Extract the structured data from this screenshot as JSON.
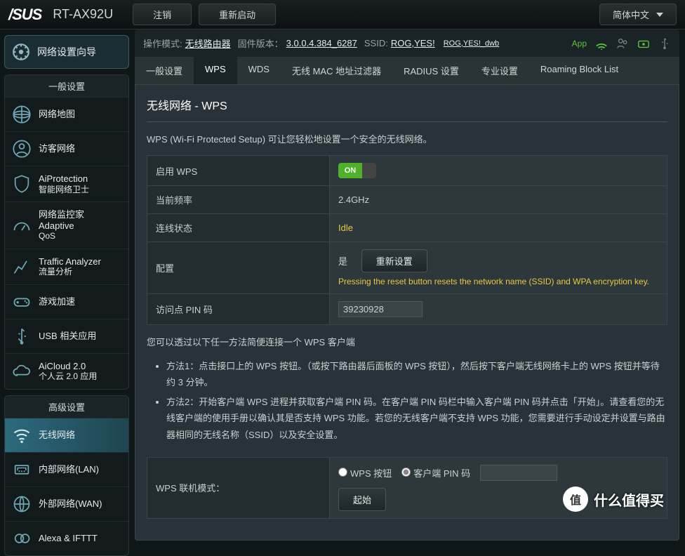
{
  "topbar": {
    "logo": "/SUS",
    "model": "RT-AX92U",
    "logout": "注销",
    "reboot": "重新启动",
    "lang": "简体中文"
  },
  "status": {
    "mode_label": "操作模式:",
    "mode": "无线路由器",
    "fw_label": "固件版本：",
    "fw": "3.0.0.4.384_6287",
    "ssid_label": "SSID:",
    "ssid1": "ROG,YES!",
    "ssid2": "ROG,YES!_dwb",
    "app": "App"
  },
  "wizard": "网络设置向导",
  "panel1_title": "一般设置",
  "panel2_title": "高级设置",
  "nav1": [
    {
      "l1": "网络地图"
    },
    {
      "l1": "访客网络"
    },
    {
      "l1": "AiProtection",
      "l2": "智能网络卫士"
    },
    {
      "l1": "网络监控家 Adaptive",
      "l2": "QoS"
    },
    {
      "l1": "Traffic Analyzer",
      "l2": "流量分析"
    },
    {
      "l1": "游戏加速"
    },
    {
      "l1": "USB 相关应用"
    },
    {
      "l1": "AiCloud 2.0",
      "l2": "个人云 2.0 应用"
    }
  ],
  "nav2": [
    {
      "l1": "无线网络"
    },
    {
      "l1": "内部网络(LAN)"
    },
    {
      "l1": "外部网络(WAN)"
    },
    {
      "l1": "Alexa & IFTTT"
    }
  ],
  "tabs": [
    "一般设置",
    "WPS",
    "WDS",
    "无线 MAC 地址过滤器",
    "RADIUS 设置",
    "专业设置",
    "Roaming Block List"
  ],
  "page_title": "无线网络 - WPS",
  "desc": "WPS (Wi-Fi Protected Setup) 可让您轻松地设置一个安全的无线网络。",
  "rows": {
    "enable": "启用 WPS",
    "freq": "当前频率",
    "freq_val": "2.4GHz",
    "conn": "连线状态",
    "conn_val": "Idle",
    "config": "配置",
    "config_val": "是",
    "reset_btn": "重新设置",
    "reset_hint": "Pressing the reset button resets the network name (SSID) and WPA encryption key.",
    "pin": "访问点 PIN 码",
    "pin_val": "39230928"
  },
  "methods_intro": "您可以透过以下任一方法简便连接一个 WPS 客户端",
  "method1": "方法1：点击接口上的 WPS 按钮。（或按下路由器后面板的 WPS 按钮），然后按下客户端无线网络卡上的 WPS 按钮并等待约 3 分钟。",
  "method2": "方法2：开始客户端 WPS 进程并获取客户端 PIN 码。在客户端 PIN 码栏中输入客户端 PIN 码并点击「开始」。请查看您的无线客户端的使用手册以确认其是否支持 WPS 功能。若您的无线客户端不支持 WPS 功能，您需要进行手动设定并设置与路由器相同的无线名称（SSID）以及安全设置。",
  "mode_label": "WPS 联机模式：",
  "radio1": "WPS 按钮",
  "radio2": "客户端 PIN 码",
  "start_btn": "起始",
  "wm": "什么值得买"
}
